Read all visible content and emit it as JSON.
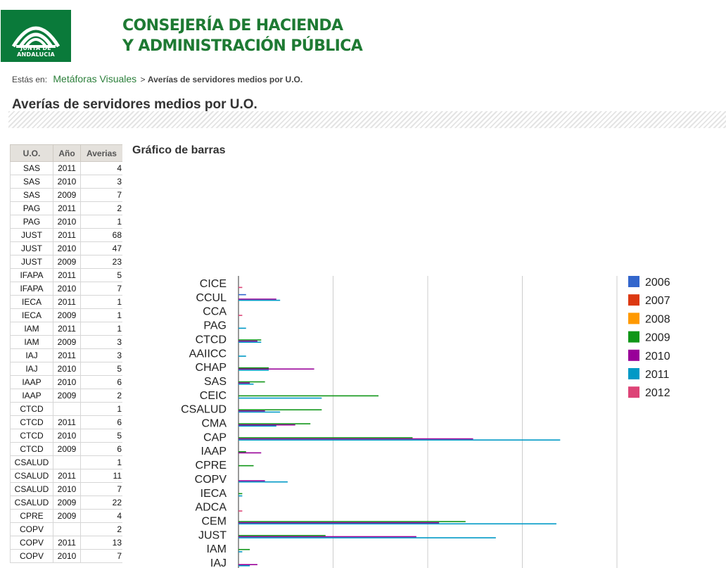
{
  "header": {
    "logo_text": "JUNTA DE ANDALUCIA",
    "dept_line1": "CONSEJERÍA DE HACIENDA",
    "dept_line2": "Y ADMINISTRACIÓN PÚBLICA",
    "brand_color": "#1e7a33"
  },
  "breadcrumb": {
    "label": "Estás en:",
    "link": "Metáforas Visuales",
    "separator": ">",
    "current": "Averías de servidores medios por U.O."
  },
  "page_title": "Averías de servidores medios por U.O.",
  "table": {
    "headers": [
      "U.O.",
      "Año",
      "Averias"
    ],
    "rows": [
      [
        "SAS",
        "2011",
        "4"
      ],
      [
        "SAS",
        "2010",
        "3"
      ],
      [
        "SAS",
        "2009",
        "7"
      ],
      [
        "PAG",
        "2011",
        "2"
      ],
      [
        "PAG",
        "2010",
        "1"
      ],
      [
        "JUST",
        "2011",
        "68"
      ],
      [
        "JUST",
        "2010",
        "47"
      ],
      [
        "JUST",
        "2009",
        "23"
      ],
      [
        "IFAPA",
        "2011",
        "5"
      ],
      [
        "IFAPA",
        "2010",
        "7"
      ],
      [
        "IECA",
        "2011",
        "1"
      ],
      [
        "IECA",
        "2009",
        "1"
      ],
      [
        "IAM",
        "2011",
        "1"
      ],
      [
        "IAM",
        "2009",
        "3"
      ],
      [
        "IAJ",
        "2011",
        "3"
      ],
      [
        "IAJ",
        "2010",
        "5"
      ],
      [
        "IAAP",
        "2010",
        "6"
      ],
      [
        "IAAP",
        "2009",
        "2"
      ],
      [
        "CTCD",
        "",
        "1"
      ],
      [
        "CTCD",
        "2011",
        "6"
      ],
      [
        "CTCD",
        "2010",
        "5"
      ],
      [
        "CTCD",
        "2009",
        "6"
      ],
      [
        "CSALUD",
        "",
        "1"
      ],
      [
        "CSALUD",
        "2011",
        "11"
      ],
      [
        "CSALUD",
        "2010",
        "7"
      ],
      [
        "CSALUD",
        "2009",
        "22"
      ],
      [
        "CPRE",
        "2009",
        "4"
      ],
      [
        "COPV",
        "",
        "2"
      ],
      [
        "COPV",
        "2011",
        "13"
      ],
      [
        "COPV",
        "2010",
        "7"
      ]
    ]
  },
  "chart_title": "Gráfico de barras",
  "chart_data": {
    "type": "bar",
    "orientation": "horizontal",
    "grid": true,
    "legend": "right",
    "xlim": [
      0,
      100
    ],
    "categories": [
      "CICE",
      "CCUL",
      "CCA",
      "PAG",
      "CTCD",
      "AAIICC",
      "CHAP",
      "SAS",
      "CEIC",
      "CSALUD",
      "CMA",
      "CAP",
      "IAAP",
      "CPRE",
      "COPV",
      "IECA",
      "ADCA",
      "CEM",
      "JUST",
      "IAM",
      "IAJ"
    ],
    "series": [
      {
        "name": "2006",
        "color": "#3366cc",
        "values": [
          0,
          2,
          0,
          0,
          0,
          0,
          0,
          0,
          0,
          0,
          0,
          0,
          0,
          0,
          0,
          0,
          0,
          0,
          0,
          0,
          0
        ]
      },
      {
        "name": "2007",
        "color": "#dc3912",
        "values": [
          0,
          0,
          0,
          0,
          0,
          0,
          0,
          0,
          0,
          0,
          0,
          0,
          0,
          0,
          0,
          0,
          0,
          0,
          0,
          0,
          0
        ]
      },
      {
        "name": "2008",
        "color": "#ff9900",
        "values": [
          0,
          0,
          0,
          0,
          0,
          0,
          0,
          0,
          0,
          0,
          0,
          0,
          0,
          0,
          0,
          0,
          0,
          0,
          0,
          0,
          0
        ]
      },
      {
        "name": "2009",
        "color": "#109618",
        "values": [
          0,
          0,
          0,
          0,
          6,
          0,
          8,
          7,
          37,
          22,
          19,
          46,
          2,
          4,
          0,
          1,
          0,
          60,
          23,
          3,
          0
        ]
      },
      {
        "name": "2010",
        "color": "#990099",
        "values": [
          0,
          10,
          0,
          0,
          5,
          0,
          20,
          3,
          0,
          7,
          15,
          62,
          6,
          0,
          7,
          0,
          0,
          53,
          47,
          0,
          5
        ]
      },
      {
        "name": "2011",
        "color": "#0099c6",
        "values": [
          0,
          11,
          0,
          2,
          6,
          2,
          8,
          4,
          22,
          11,
          10,
          85,
          0,
          0,
          13,
          1,
          0,
          84,
          68,
          1,
          3
        ]
      },
      {
        "name": "2012",
        "color": "#dd4477",
        "values": [
          1,
          0,
          1,
          0,
          0,
          0,
          0,
          0,
          0,
          0,
          0,
          0,
          0,
          0,
          0,
          0,
          1,
          0,
          0,
          0,
          0
        ]
      }
    ]
  }
}
